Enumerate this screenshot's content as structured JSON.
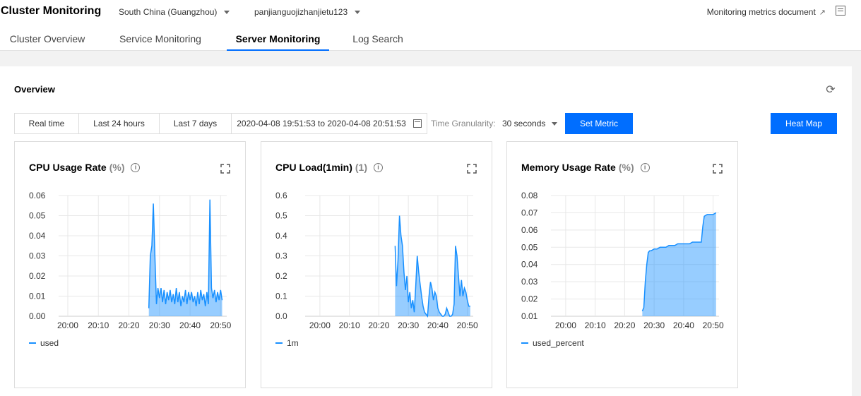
{
  "header": {
    "title": "Cluster Monitoring",
    "region": "South China (Guangzhou)",
    "cluster": "panjianguojizhanjietu123",
    "doc_link": "Monitoring metrics document"
  },
  "tabs": [
    {
      "label": "Cluster Overview",
      "active": false
    },
    {
      "label": "Service Monitoring",
      "active": false
    },
    {
      "label": "Server Monitoring",
      "active": true
    },
    {
      "label": "Log Search",
      "active": false
    }
  ],
  "overview": {
    "title": "Overview",
    "time_buttons": [
      "Real time",
      "Last 24 hours",
      "Last 7 days"
    ],
    "time_range": "2020-04-08 19:51:53 to 2020-04-08 20:51:53",
    "granularity_label": "Time Granularity:",
    "granularity_value": "30 seconds",
    "set_metric": "Set Metric",
    "heat_map": "Heat Map"
  },
  "accent_color": "#006eff",
  "chart_data": [
    {
      "type": "area",
      "title": "CPU Usage Rate",
      "unit": "(%)",
      "x_ticks": [
        "20:00",
        "20:10",
        "20:20",
        "20:30",
        "20:40",
        "20:50"
      ],
      "y_ticks": [
        "0.06",
        "0.05",
        "0.04",
        "0.03",
        "0.02",
        "0.01",
        "0.00"
      ],
      "ylim": [
        0,
        0.06
      ],
      "xlim_minutes": [
        -3,
        52
      ],
      "grid": true,
      "legend_position": "bottom-left",
      "series": [
        {
          "name": "used",
          "x": [
            26.5,
            27,
            27.5,
            28,
            28.5,
            29,
            29.5,
            30,
            30.5,
            31,
            31.5,
            32,
            32.5,
            33,
            33.5,
            34,
            34.5,
            35,
            35.5,
            36,
            36.5,
            37,
            37.5,
            38,
            38.5,
            39,
            39.5,
            40,
            40.5,
            41,
            41.5,
            42,
            42.5,
            43,
            43.5,
            44,
            44.5,
            45,
            45.5,
            46,
            46.5,
            47,
            47.5,
            48,
            48.5,
            49,
            49.5,
            50,
            50.5
          ],
          "values": [
            0.004,
            0.03,
            0.035,
            0.056,
            0.03,
            0.006,
            0.014,
            0.009,
            0.014,
            0.007,
            0.013,
            0.006,
            0.012,
            0.008,
            0.013,
            0.007,
            0.011,
            0.006,
            0.014,
            0.007,
            0.012,
            0.005,
            0.01,
            0.007,
            0.013,
            0.006,
            0.012,
            0.008,
            0.012,
            0.007,
            0.01,
            0.005,
            0.012,
            0.006,
            0.013,
            0.008,
            0.011,
            0.005,
            0.012,
            0.006,
            0.058,
            0.014,
            0.009,
            0.013,
            0.007,
            0.012,
            0.008,
            0.013,
            0.008
          ]
        }
      ]
    },
    {
      "type": "area",
      "title": "CPU Load(1min)",
      "unit": "(1)",
      "x_ticks": [
        "20:00",
        "20:10",
        "20:20",
        "20:30",
        "20:40",
        "20:50"
      ],
      "y_ticks": [
        "0.6",
        "0.5",
        "0.4",
        "0.3",
        "0.2",
        "0.1",
        "0.0"
      ],
      "ylim": [
        0,
        0.6
      ],
      "xlim_minutes": [
        -5,
        52
      ],
      "grid": true,
      "legend_position": "bottom-left",
      "series": [
        {
          "name": "1m",
          "x": [
            25.5,
            26,
            26.5,
            27,
            27.5,
            28,
            28.5,
            29,
            29.5,
            30,
            30.5,
            31,
            31.5,
            32,
            32.5,
            33,
            33.5,
            34,
            34.5,
            35,
            35.5,
            36,
            36.5,
            37,
            37.5,
            38,
            38.5,
            39,
            39.5,
            40,
            40.5,
            41,
            41.5,
            42,
            42.5,
            43,
            43.5,
            44,
            44.5,
            45,
            45.5,
            46,
            46.5,
            47,
            47.5,
            48,
            48.5,
            49,
            49.5,
            50,
            50.5,
            51
          ],
          "values": [
            0.35,
            0.15,
            0.28,
            0.5,
            0.4,
            0.35,
            0.22,
            0.13,
            0.2,
            0.07,
            0.12,
            0.04,
            0.08,
            0.02,
            0.15,
            0.3,
            0.22,
            0.16,
            0.1,
            0.05,
            0.02,
            0.01,
            0.0,
            0.1,
            0.17,
            0.14,
            0.08,
            0.12,
            0.1,
            0.04,
            0.02,
            0.01,
            0.0,
            0.0,
            0.01,
            0.04,
            0.02,
            0.0,
            0.0,
            0.01,
            0.06,
            0.35,
            0.3,
            0.2,
            0.1,
            0.18,
            0.1,
            0.14,
            0.12,
            0.08,
            0.05,
            0.05
          ]
        }
      ]
    },
    {
      "type": "area",
      "title": "Memory Usage Rate",
      "unit": "(%)",
      "x_ticks": [
        "20:00",
        "20:10",
        "20:20",
        "20:30",
        "20:40",
        "20:50"
      ],
      "y_ticks": [
        "0.08",
        "0.07",
        "0.06",
        "0.05",
        "0.04",
        "0.03",
        "0.02",
        "0.01"
      ],
      "ylim": [
        0.01,
        0.08
      ],
      "xlim_minutes": [
        -5,
        52
      ],
      "grid": true,
      "legend_position": "bottom-left",
      "series": [
        {
          "name": "used_percent",
          "x": [
            26,
            26.5,
            27,
            27.5,
            28,
            28.5,
            29,
            30,
            31,
            32,
            33,
            34,
            35,
            36,
            37,
            38,
            39,
            40,
            41,
            42,
            43,
            44,
            45,
            46,
            46.5,
            47,
            48,
            49,
            50,
            51
          ],
          "values": [
            0.013,
            0.015,
            0.03,
            0.04,
            0.047,
            0.048,
            0.048,
            0.049,
            0.049,
            0.05,
            0.05,
            0.05,
            0.051,
            0.051,
            0.051,
            0.052,
            0.052,
            0.052,
            0.052,
            0.052,
            0.053,
            0.053,
            0.053,
            0.053,
            0.062,
            0.068,
            0.069,
            0.069,
            0.069,
            0.07
          ]
        }
      ]
    }
  ]
}
